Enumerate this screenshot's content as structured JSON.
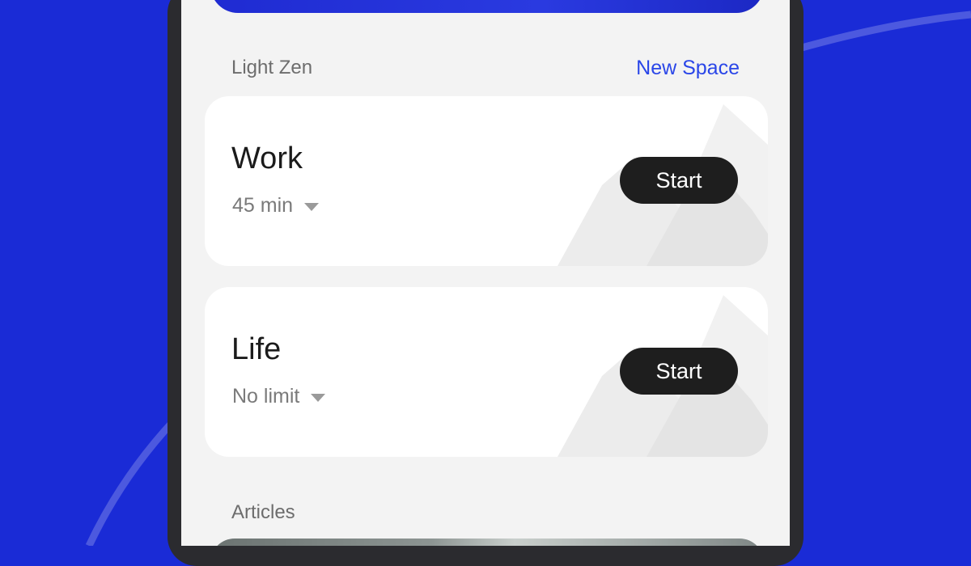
{
  "colors": {
    "background": "#1a2bd6",
    "accent": "#2a46e8",
    "button": "#1e1e1e"
  },
  "light_zen": {
    "title": "Light Zen",
    "new_space_label": "New Space"
  },
  "spaces": [
    {
      "title": "Work",
      "duration": "45 min",
      "start_label": "Start"
    },
    {
      "title": "Life",
      "duration": "No limit",
      "start_label": "Start"
    }
  ],
  "articles": {
    "title": "Articles"
  }
}
